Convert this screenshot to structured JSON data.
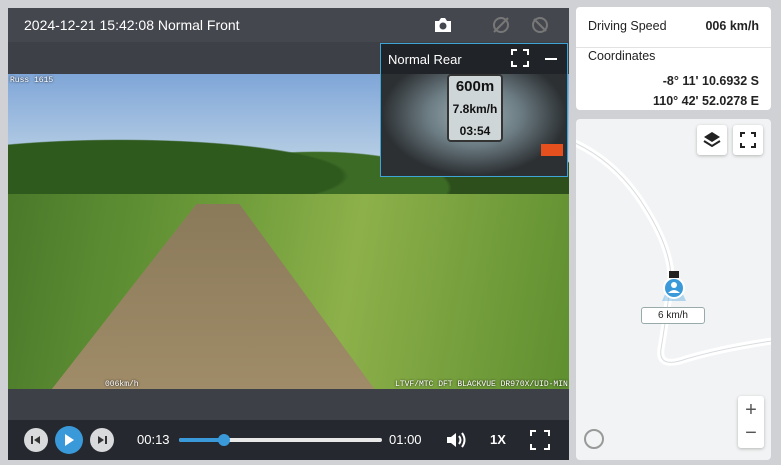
{
  "player": {
    "title": "2024-12-21 15:42:08 Normal Front",
    "icons": [
      "camera-icon",
      "no-location-icon",
      "no-sound-icon"
    ],
    "osd_top_left": "Russ 1615",
    "osd_speed": "006km/h",
    "osd_bottom_right": "LTVF/MTC DFT BLACKVUE DR970X/UID-MIN"
  },
  "pip": {
    "label": "Normal Rear",
    "gauge": [
      "600m",
      "7.8km/h",
      "03:54"
    ]
  },
  "controls": {
    "current_time": "00:13",
    "duration": "01:00",
    "progress": 0.22,
    "speed": "1X"
  },
  "info": {
    "speed_label": "Driving Speed",
    "speed_value": "006 km/h",
    "coords_label": "Coordinates",
    "lat": "-8° 11' 10.6932 S",
    "lon": "110° 42' 52.0278 E"
  },
  "map": {
    "marker_speed": "6 km/h",
    "colors": {
      "accent": "#3a9ad9",
      "road": "#ffffff"
    }
  }
}
